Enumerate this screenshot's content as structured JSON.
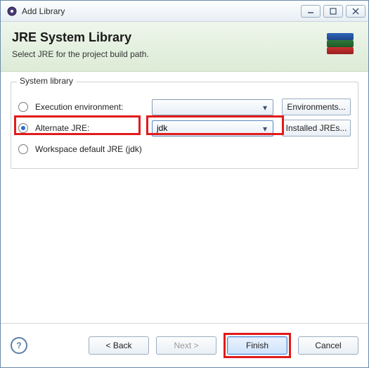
{
  "window": {
    "title": "Add Library"
  },
  "banner": {
    "title": "JRE System Library",
    "subtitle": "Select JRE for the project build path."
  },
  "group": {
    "label": "System library",
    "options": {
      "exec_env": {
        "label": "Execution environment:",
        "value": "",
        "button": "Environments..."
      },
      "alt_jre": {
        "label": "Alternate JRE:",
        "value": "jdk",
        "button": "Installed JREs..."
      },
      "workspace": {
        "label": "Workspace default JRE (jdk)"
      }
    }
  },
  "footer": {
    "back": "< Back",
    "next": "Next >",
    "finish": "Finish",
    "cancel": "Cancel"
  }
}
